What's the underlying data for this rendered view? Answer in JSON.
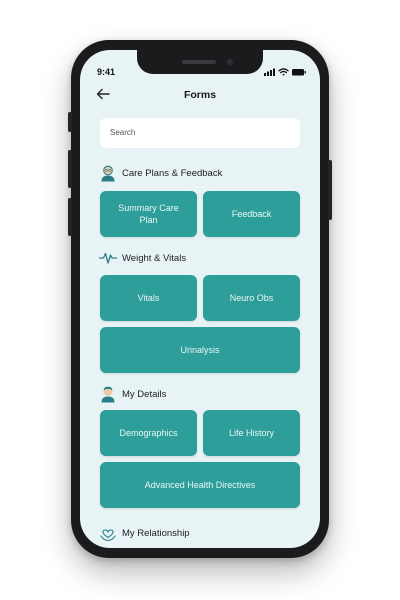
{
  "status": {
    "time": "9:41"
  },
  "header": {
    "title": "Forms"
  },
  "search": {
    "placeholder": "Search"
  },
  "sections": {
    "care": {
      "title": "Care Plans & Feedback",
      "tiles": [
        "Summary Care Plan",
        "Feedback"
      ]
    },
    "vitals": {
      "title": "Weight & Vitals",
      "tiles": [
        "Vitals",
        "Neuro Obs",
        "Urinalysis"
      ]
    },
    "details": {
      "title": "My Details",
      "tiles": [
        "Demographics",
        "Life History",
        "Advanced Health Directives"
      ]
    },
    "relationship": {
      "title": "My Relationship"
    }
  },
  "colors": {
    "accent": "#2d9e9a",
    "screen_bg": "#e8f3f6",
    "frame": "#1b1b1d"
  },
  "icons": {
    "back": "arrow-left-icon",
    "care": "nurse-avatar-icon",
    "vitals": "heartbeat-icon",
    "details": "person-avatar-icon",
    "relationship": "heart-hands-icon"
  }
}
